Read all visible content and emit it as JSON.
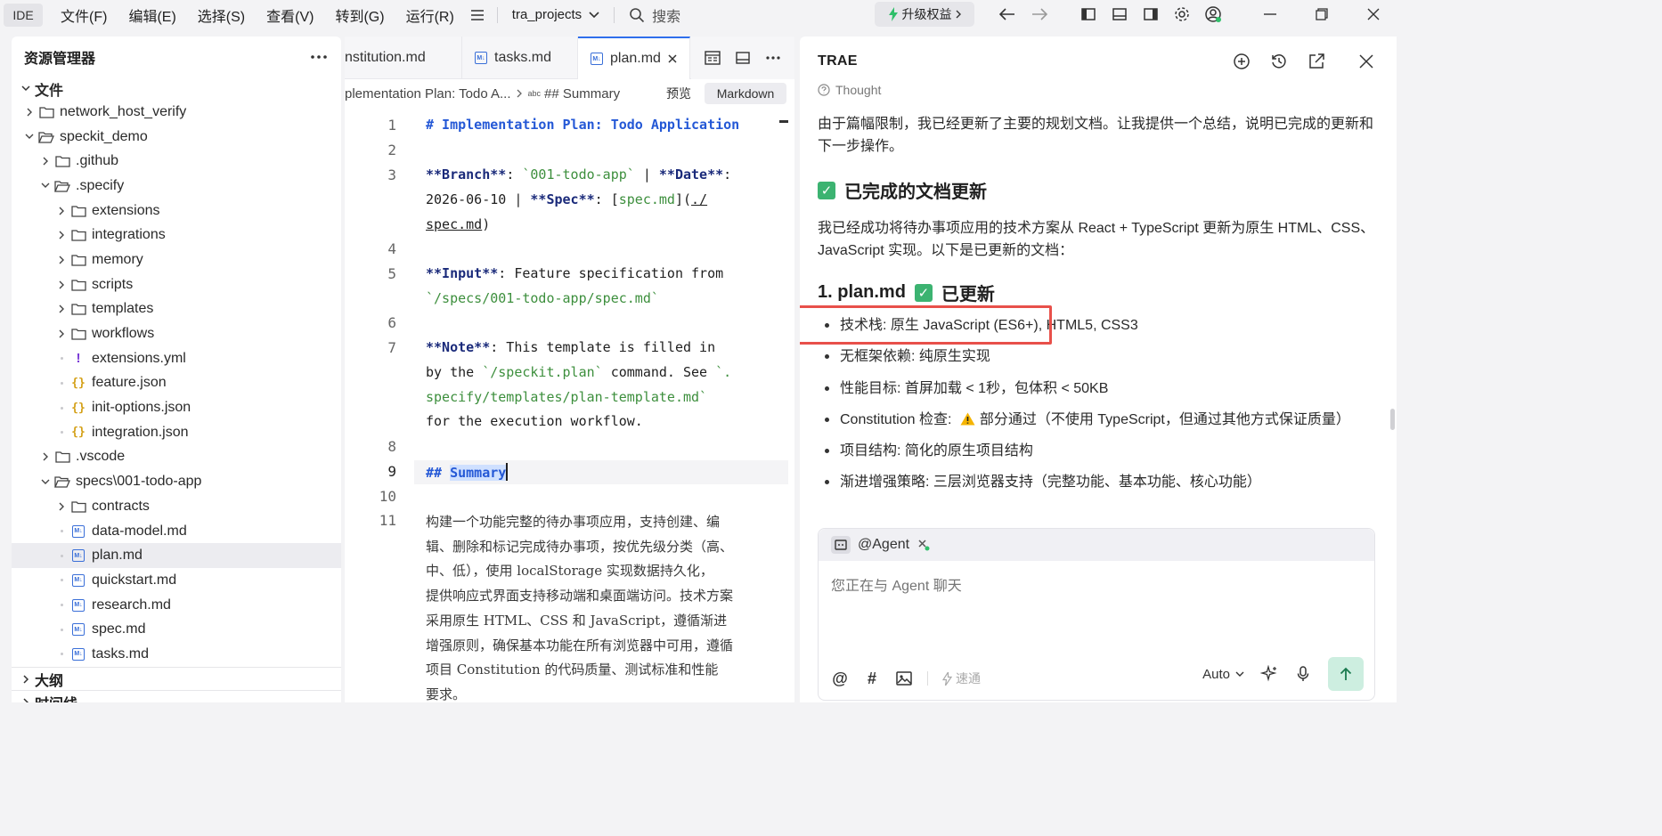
{
  "titlebar": {
    "badge": "IDE",
    "menu": [
      "文件(F)",
      "编辑(E)",
      "选择(S)",
      "查看(V)",
      "转到(G)",
      "运行(R)"
    ],
    "project": "tra_projects",
    "search_placeholder": "搜索",
    "upgrade_label": "升级权益"
  },
  "explorer": {
    "title": "资源管理器",
    "section_files": "文件",
    "tree": [
      {
        "label": "network_host_verify",
        "depth": 0,
        "type": "folder",
        "open": false
      },
      {
        "label": "speckit_demo",
        "depth": 0,
        "type": "folder",
        "open": true
      },
      {
        "label": ".github",
        "depth": 1,
        "type": "folder",
        "open": false
      },
      {
        "label": ".specify",
        "depth": 1,
        "type": "folder",
        "open": true
      },
      {
        "label": "extensions",
        "depth": 2,
        "type": "folder",
        "open": false
      },
      {
        "label": "integrations",
        "depth": 2,
        "type": "folder",
        "open": false
      },
      {
        "label": "memory",
        "depth": 2,
        "type": "folder",
        "open": false
      },
      {
        "label": "scripts",
        "depth": 2,
        "type": "folder",
        "open": false
      },
      {
        "label": "templates",
        "depth": 2,
        "type": "folder",
        "open": false
      },
      {
        "label": "workflows",
        "depth": 2,
        "type": "folder",
        "open": false
      },
      {
        "label": "extensions.yml",
        "depth": 2,
        "type": "yml"
      },
      {
        "label": "feature.json",
        "depth": 2,
        "type": "json"
      },
      {
        "label": "init-options.json",
        "depth": 2,
        "type": "json"
      },
      {
        "label": "integration.json",
        "depth": 2,
        "type": "json"
      },
      {
        "label": ".vscode",
        "depth": 1,
        "type": "folder",
        "open": false
      },
      {
        "label": "specs\\001-todo-app",
        "depth": 1,
        "type": "folder",
        "open": true
      },
      {
        "label": "contracts",
        "depth": 2,
        "type": "folder",
        "open": false
      },
      {
        "label": "data-model.md",
        "depth": 2,
        "type": "md"
      },
      {
        "label": "plan.md",
        "depth": 2,
        "type": "md",
        "selected": true
      },
      {
        "label": "quickstart.md",
        "depth": 2,
        "type": "md"
      },
      {
        "label": "research.md",
        "depth": 2,
        "type": "md"
      },
      {
        "label": "spec.md",
        "depth": 2,
        "type": "md"
      },
      {
        "label": "tasks.md",
        "depth": 2,
        "type": "md"
      }
    ],
    "section_outline": "大纲",
    "section_timeline": "时间线"
  },
  "editor": {
    "tabs": [
      {
        "label": "nstitution.md"
      },
      {
        "label": "tasks.md"
      },
      {
        "label": "plan.md",
        "active": true
      }
    ],
    "breadcrumb_file": "plementation Plan: Todo A...",
    "breadcrumb_symbol": "## Summary",
    "preview_label": "预览",
    "markdown_label": "Markdown",
    "line_numbers": [
      "1",
      "2",
      "3",
      "4",
      "5",
      "6",
      "7",
      "8",
      "9",
      "10",
      "11"
    ],
    "lines": {
      "l1": "# Implementation Plan: Todo Application",
      "l3a_b1": "**Branch**",
      "l3a_t1": ": ",
      "l3a_c1": "`001-todo-app`",
      "l3a_t2": " | ",
      "l3a_b2": "**Date**",
      "l3a_t3": ":",
      "l3b_t1": "2026-06-10 | ",
      "l3b_b1": "**Spec**",
      "l3b_t2": ": [",
      "l3b_c1": "spec.md",
      "l3b_t3": "](",
      "l3b_u1": "./",
      "l3c_u1": "spec.md",
      "l3c_t1": ")",
      "l5a_b1": "**Input**",
      "l5a_t1": ": Feature specification from",
      "l5b_c1": "`/specs/001-todo-app/spec.md`",
      "l7a_b1": "**Note**",
      "l7a_t1": ": This template is filled in",
      "l7b_t1": "by the ",
      "l7b_c1": "`/speckit.plan`",
      "l7b_t2": " command. See ",
      "l7b_c2": "`.",
      "l7c_c1": "specify/templates/plan-template.md`",
      "l7d_t1": "for the execution workflow.",
      "l9_h": "## ",
      "l9_w": "Summary",
      "l11": [
        "构建一个功能完整的待办事项应用，支持创建、编",
        "辑、删除和标记完成待办事项，按优先级分类（高、",
        "中、低），使用 localStorage 实现数据持久化，",
        "提供响应式界面支持移动端和桌面端访问。技术方案",
        "采用原生 HTML、CSS 和 JavaScript，遵循渐进",
        "增强原则，确保基本功能在所有浏览器中可用，遵循",
        "项目 Constitution 的代码质量、测试标准和性能",
        "要求。"
      ]
    }
  },
  "trae": {
    "title": "TRAE",
    "thought_label": "Thought",
    "intro": "由于篇幅限制，我已经更新了主要的规划文档。让我提供一个总结，说明已完成的更新和下一步操作。",
    "heading_done": "已完成的文档更新",
    "summary": "我已经成功将待办事项应用的技术方案从 React + TypeScript 更新为原生 HTML、CSS、JavaScript 实现。以下是已更新的文档：",
    "item_title": "1. plan.md",
    "item_status": "已更新",
    "bullets": [
      "技术栈: 原生 JavaScript (ES6+), HTML5, CSS3",
      "无框架依赖: 纯原生实现",
      "性能目标: 首屏加载 < 1秒，包体积 < 50KB"
    ],
    "bullet_constitution_pre": "Constitution 检查: ",
    "bullet_constitution_post": "部分通过（不使用 TypeScript，但通过其他方式保证质量）",
    "bullets_after": [
      "项目结构: 简化的原生项目结构",
      "渐进增强策略: 三层浏览器支持（完整功能、基本功能、核心功能）"
    ],
    "chat": {
      "agent_label": "@Agent",
      "placeholder": "您正在与 Agent 聊天",
      "speed_label": "速通",
      "mode_label": "Auto"
    }
  }
}
